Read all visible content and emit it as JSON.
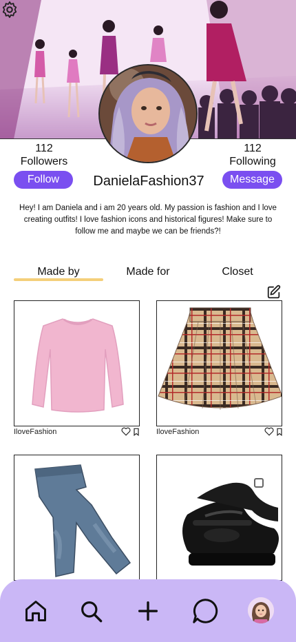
{
  "profile": {
    "username": "DanielaFashion37",
    "followers_count": "112",
    "followers_label": "Followers",
    "following_count": "112",
    "following_label": "Following",
    "follow_button": "Follow",
    "message_button": "Message",
    "bio": "Hey! I am Daniela and i am 20 years old. My passion is fashion and I love creating outfits! I love fashion icons and historical figures! Make sure to follow me and maybe we can be friends?!"
  },
  "tabs": [
    {
      "label": "Made by",
      "active": true
    },
    {
      "label": "Made for",
      "active": false
    },
    {
      "label": "Closet",
      "active": false
    }
  ],
  "items": [
    {
      "caption": "IloveFashion",
      "kind": "pink-sweater"
    },
    {
      "caption": "IloveFashion",
      "kind": "plaid-skirt"
    },
    {
      "caption": "",
      "kind": "jeans"
    },
    {
      "caption": "",
      "kind": "black-shoes"
    }
  ],
  "icons": {
    "settings": "gear-icon",
    "edit": "edit-icon",
    "like": "heart-icon",
    "save": "bookmark-icon",
    "nav": [
      "home-icon",
      "search-icon",
      "plus-icon",
      "chat-icon"
    ]
  },
  "colors": {
    "accent": "#7a4ff0",
    "tab_underline": "#f4cf7a",
    "navbar": "#cab7f6"
  }
}
